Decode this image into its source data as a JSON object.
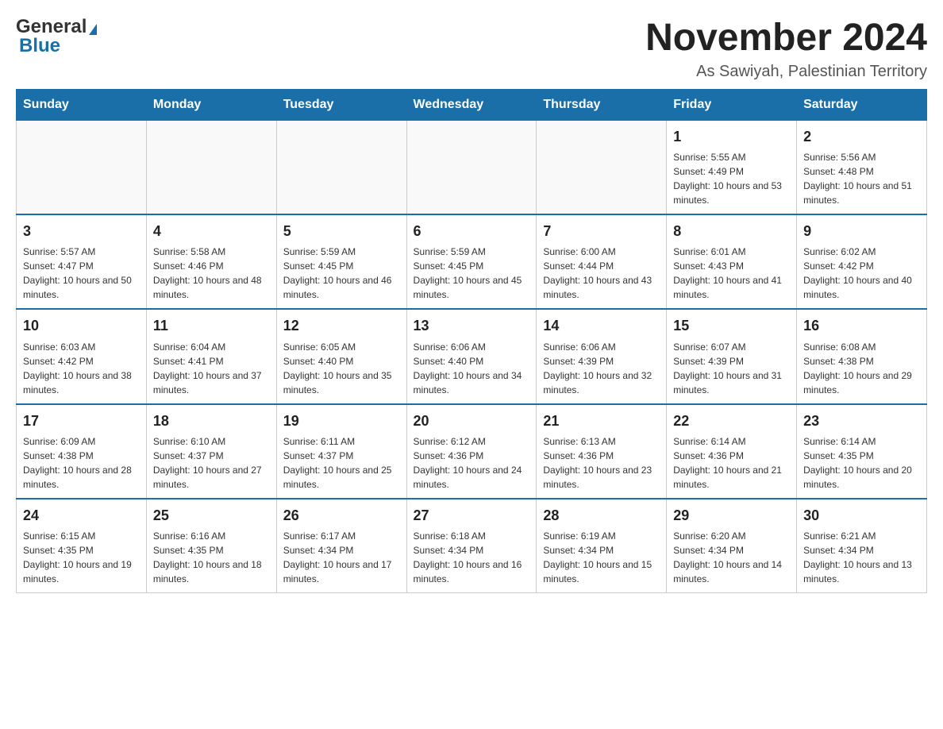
{
  "header": {
    "logo_general": "General",
    "logo_blue": "Blue",
    "month_title": "November 2024",
    "subtitle": "As Sawiyah, Palestinian Territory"
  },
  "days_of_week": [
    "Sunday",
    "Monday",
    "Tuesday",
    "Wednesday",
    "Thursday",
    "Friday",
    "Saturday"
  ],
  "weeks": [
    [
      {
        "day": "",
        "info": ""
      },
      {
        "day": "",
        "info": ""
      },
      {
        "day": "",
        "info": ""
      },
      {
        "day": "",
        "info": ""
      },
      {
        "day": "",
        "info": ""
      },
      {
        "day": "1",
        "info": "Sunrise: 5:55 AM\nSunset: 4:49 PM\nDaylight: 10 hours and 53 minutes."
      },
      {
        "day": "2",
        "info": "Sunrise: 5:56 AM\nSunset: 4:48 PM\nDaylight: 10 hours and 51 minutes."
      }
    ],
    [
      {
        "day": "3",
        "info": "Sunrise: 5:57 AM\nSunset: 4:47 PM\nDaylight: 10 hours and 50 minutes."
      },
      {
        "day": "4",
        "info": "Sunrise: 5:58 AM\nSunset: 4:46 PM\nDaylight: 10 hours and 48 minutes."
      },
      {
        "day": "5",
        "info": "Sunrise: 5:59 AM\nSunset: 4:45 PM\nDaylight: 10 hours and 46 minutes."
      },
      {
        "day": "6",
        "info": "Sunrise: 5:59 AM\nSunset: 4:45 PM\nDaylight: 10 hours and 45 minutes."
      },
      {
        "day": "7",
        "info": "Sunrise: 6:00 AM\nSunset: 4:44 PM\nDaylight: 10 hours and 43 minutes."
      },
      {
        "day": "8",
        "info": "Sunrise: 6:01 AM\nSunset: 4:43 PM\nDaylight: 10 hours and 41 minutes."
      },
      {
        "day": "9",
        "info": "Sunrise: 6:02 AM\nSunset: 4:42 PM\nDaylight: 10 hours and 40 minutes."
      }
    ],
    [
      {
        "day": "10",
        "info": "Sunrise: 6:03 AM\nSunset: 4:42 PM\nDaylight: 10 hours and 38 minutes."
      },
      {
        "day": "11",
        "info": "Sunrise: 6:04 AM\nSunset: 4:41 PM\nDaylight: 10 hours and 37 minutes."
      },
      {
        "day": "12",
        "info": "Sunrise: 6:05 AM\nSunset: 4:40 PM\nDaylight: 10 hours and 35 minutes."
      },
      {
        "day": "13",
        "info": "Sunrise: 6:06 AM\nSunset: 4:40 PM\nDaylight: 10 hours and 34 minutes."
      },
      {
        "day": "14",
        "info": "Sunrise: 6:06 AM\nSunset: 4:39 PM\nDaylight: 10 hours and 32 minutes."
      },
      {
        "day": "15",
        "info": "Sunrise: 6:07 AM\nSunset: 4:39 PM\nDaylight: 10 hours and 31 minutes."
      },
      {
        "day": "16",
        "info": "Sunrise: 6:08 AM\nSunset: 4:38 PM\nDaylight: 10 hours and 29 minutes."
      }
    ],
    [
      {
        "day": "17",
        "info": "Sunrise: 6:09 AM\nSunset: 4:38 PM\nDaylight: 10 hours and 28 minutes."
      },
      {
        "day": "18",
        "info": "Sunrise: 6:10 AM\nSunset: 4:37 PM\nDaylight: 10 hours and 27 minutes."
      },
      {
        "day": "19",
        "info": "Sunrise: 6:11 AM\nSunset: 4:37 PM\nDaylight: 10 hours and 25 minutes."
      },
      {
        "day": "20",
        "info": "Sunrise: 6:12 AM\nSunset: 4:36 PM\nDaylight: 10 hours and 24 minutes."
      },
      {
        "day": "21",
        "info": "Sunrise: 6:13 AM\nSunset: 4:36 PM\nDaylight: 10 hours and 23 minutes."
      },
      {
        "day": "22",
        "info": "Sunrise: 6:14 AM\nSunset: 4:36 PM\nDaylight: 10 hours and 21 minutes."
      },
      {
        "day": "23",
        "info": "Sunrise: 6:14 AM\nSunset: 4:35 PM\nDaylight: 10 hours and 20 minutes."
      }
    ],
    [
      {
        "day": "24",
        "info": "Sunrise: 6:15 AM\nSunset: 4:35 PM\nDaylight: 10 hours and 19 minutes."
      },
      {
        "day": "25",
        "info": "Sunrise: 6:16 AM\nSunset: 4:35 PM\nDaylight: 10 hours and 18 minutes."
      },
      {
        "day": "26",
        "info": "Sunrise: 6:17 AM\nSunset: 4:34 PM\nDaylight: 10 hours and 17 minutes."
      },
      {
        "day": "27",
        "info": "Sunrise: 6:18 AM\nSunset: 4:34 PM\nDaylight: 10 hours and 16 minutes."
      },
      {
        "day": "28",
        "info": "Sunrise: 6:19 AM\nSunset: 4:34 PM\nDaylight: 10 hours and 15 minutes."
      },
      {
        "day": "29",
        "info": "Sunrise: 6:20 AM\nSunset: 4:34 PM\nDaylight: 10 hours and 14 minutes."
      },
      {
        "day": "30",
        "info": "Sunrise: 6:21 AM\nSunset: 4:34 PM\nDaylight: 10 hours and 13 minutes."
      }
    ]
  ]
}
